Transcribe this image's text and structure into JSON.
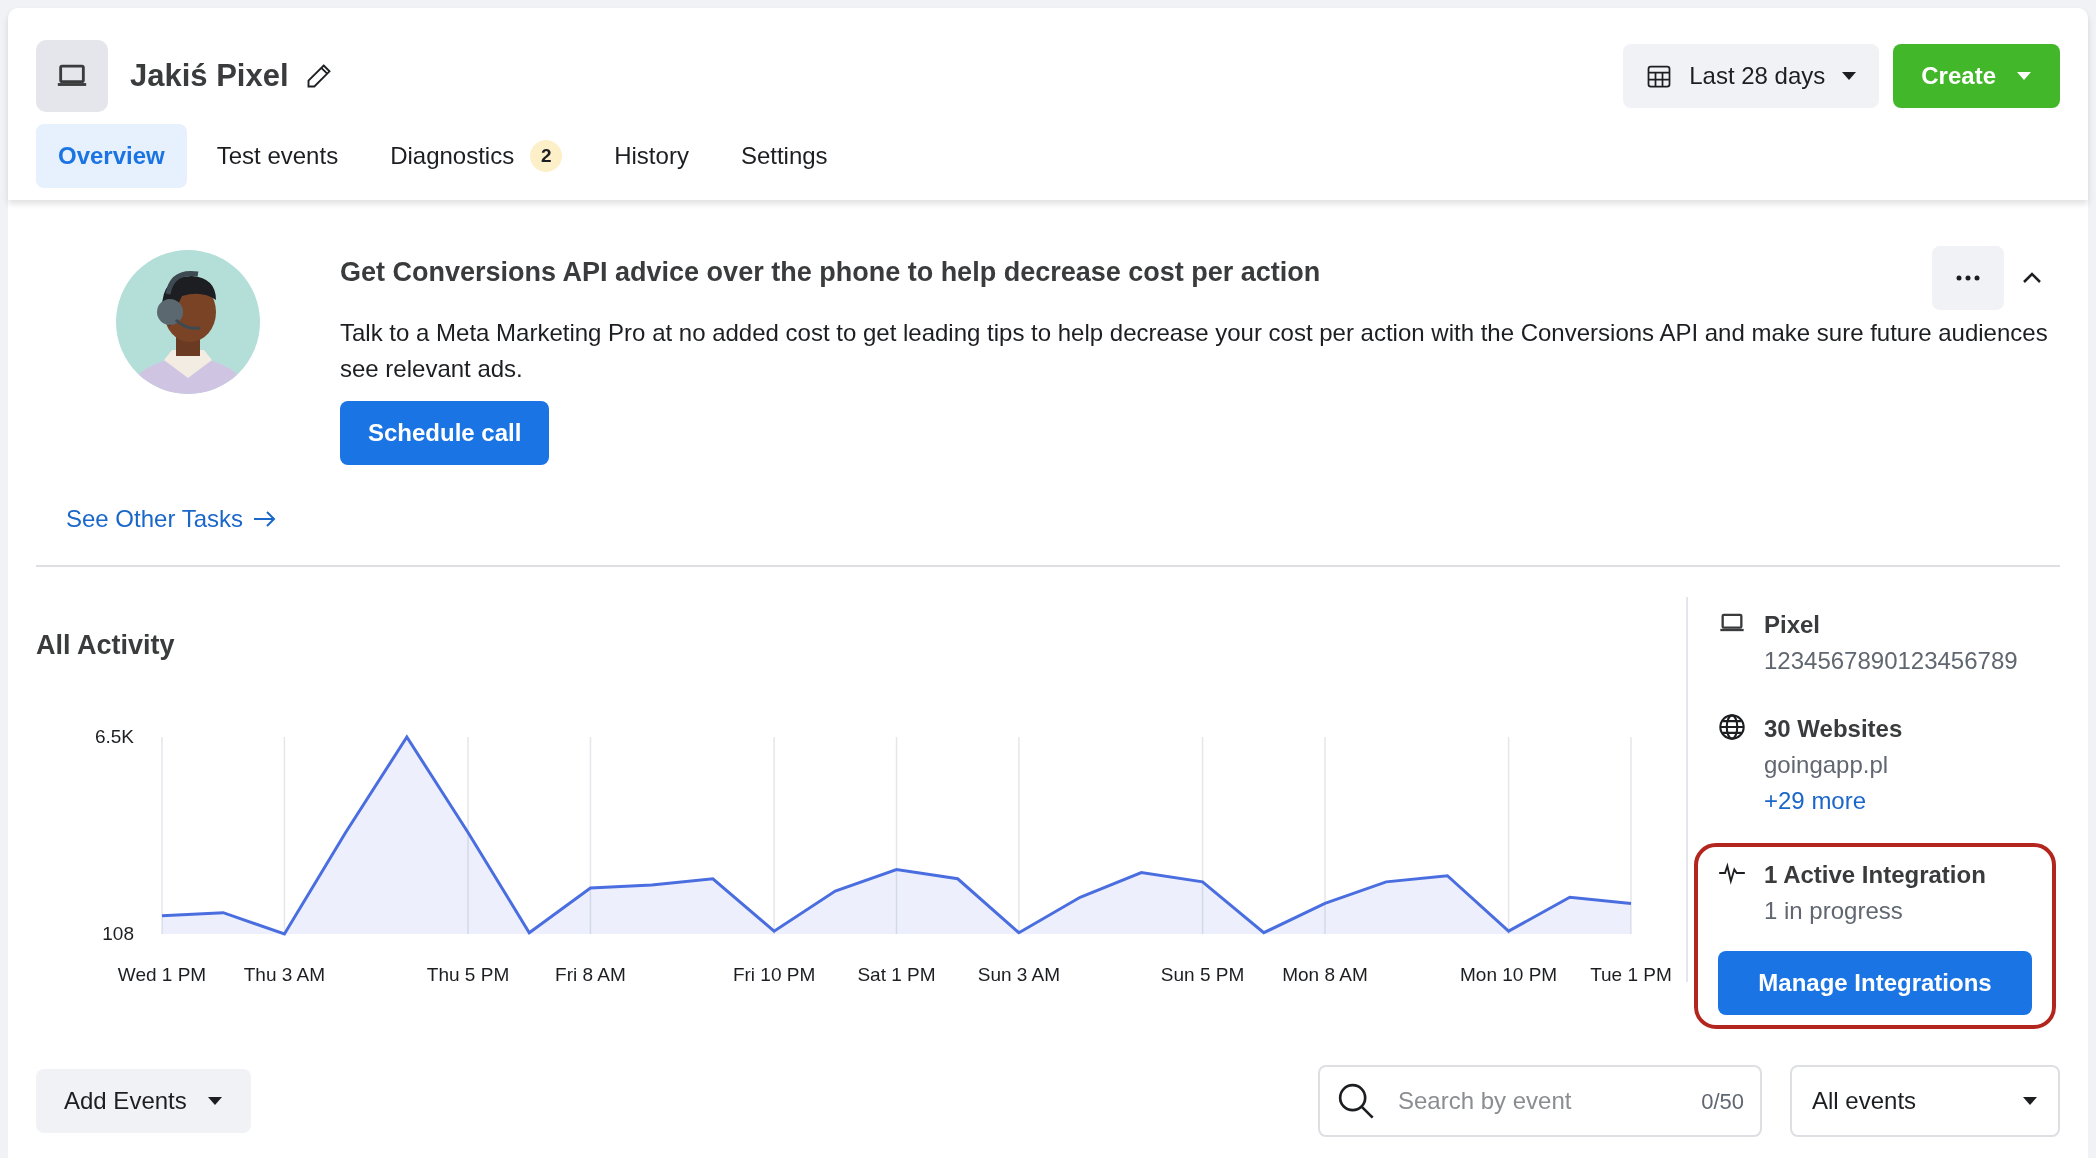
{
  "header": {
    "title": "Jakiś Pixel",
    "date_range": "Last 28 days",
    "create_button": "Create"
  },
  "tabs": [
    {
      "label": "Overview",
      "selected": true
    },
    {
      "label": "Test events",
      "selected": false
    },
    {
      "label": "Diagnostics",
      "selected": false,
      "badge": "2"
    },
    {
      "label": "History",
      "selected": false
    },
    {
      "label": "Settings",
      "selected": false
    }
  ],
  "promo": {
    "heading": "Get Conversions API advice over the phone to help decrease cost per action",
    "text": "Talk to a Meta Marketing Pro at no added cost to get leading tips to help decrease your cost per action with the Conversions API and make sure future audiences see relevant ads.",
    "button": "Schedule call",
    "expanded": true,
    "see_other": "See Other Tasks"
  },
  "activity": {
    "title": "All Activity",
    "chart_data": {
      "type": "area",
      "categories": [
        "Wed 1 PM",
        null,
        "Thu 3 AM",
        null,
        null,
        "Thu 5 PM",
        null,
        "Fri 8 AM",
        null,
        null,
        "Fri 10 PM",
        null,
        "Sat 1 PM",
        null,
        "Sun 3 AM",
        null,
        null,
        "Sun 5 PM",
        null,
        "Mon 8 AM",
        null,
        null,
        "Mon 10 PM",
        null,
        "Tue 1 PM"
      ],
      "series": [
        {
          "color": "#4a6ee0",
          "values": [
            700,
            800,
            108,
            3400,
            6500,
            3400,
            150,
            1600,
            1700,
            1900,
            200,
            1500,
            2200,
            1900,
            150,
            1300,
            2100,
            1800,
            150,
            1100,
            1800,
            2000,
            200,
            1300,
            1100
          ]
        }
      ],
      "ylim": [
        108,
        6500
      ],
      "grid": true,
      "yticks": [
        {
          "value": 108,
          "label": "108"
        },
        {
          "value": 6500,
          "label": "6.5K"
        }
      ]
    }
  },
  "info": [
    {
      "kind": "pixel",
      "title": "Pixel",
      "lines": [
        "1234567890123456789"
      ]
    },
    {
      "kind": "websites",
      "title": "30 Websites",
      "lines": [
        "goingapp.pl"
      ],
      "link": "+29 more"
    },
    {
      "kind": "integration",
      "title": "1 Active Integration",
      "lines": [
        "1 in progress"
      ],
      "button": "Manage Integrations",
      "highlighted": true
    }
  ],
  "events": {
    "add_button": "Add Events",
    "search": {
      "placeholder": "Search by event",
      "counter": "0/50"
    },
    "filter": "All events"
  }
}
